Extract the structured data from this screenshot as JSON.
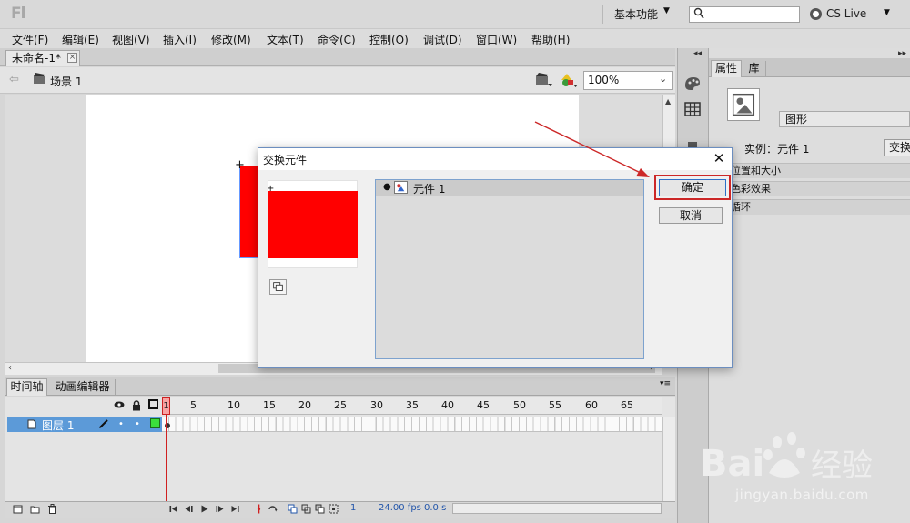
{
  "app": {
    "workspace": "基本功能",
    "cs_live": "CS Live"
  },
  "menu": [
    "文件(F)",
    "编辑(E)",
    "视图(V)",
    "插入(I)",
    "修改(M)",
    "文本(T)",
    "命令(C)",
    "控制(O)",
    "调试(D)",
    "窗口(W)",
    "帮助(H)"
  ],
  "document": {
    "tab_title": "未命名-1*",
    "scene": "场景 1",
    "zoom": "100%"
  },
  "properties": {
    "tabs": [
      "属性",
      "库"
    ],
    "type": "图形",
    "instance": "实例：元件 1",
    "swap_button": "交换",
    "sections": [
      "位置和大小",
      "色彩效果",
      "循环"
    ]
  },
  "timeline": {
    "tabs": [
      "时间轴",
      "动画编辑器"
    ],
    "frame_numbers": [
      "1",
      "5",
      "10",
      "15",
      "20",
      "25",
      "30",
      "35",
      "40",
      "45",
      "50",
      "55",
      "60",
      "65"
    ],
    "layer_name": "图层 1",
    "current_frame": "1",
    "fps": "24.00 fps",
    "time": "0.0 s"
  },
  "dialog": {
    "title": "交换元件",
    "symbol_name": "元件 1",
    "ok_label": "确定",
    "cancel_label": "取消"
  },
  "watermark": {
    "logo_text": "Bai  经验",
    "url": "jingyan.baidu.com"
  },
  "colors": {
    "symbol_fill": "#ff0000",
    "annotation": "#cc2727",
    "layer_highlight": "#5c9ad8"
  }
}
